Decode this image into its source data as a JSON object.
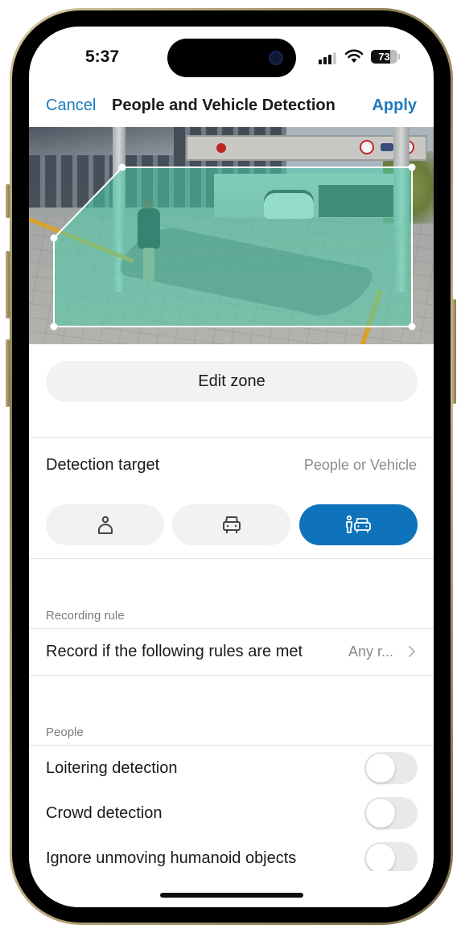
{
  "status_bar": {
    "time": "5:37",
    "battery_level": "73",
    "signal_bars_active": 3,
    "signal_bars_total": 4
  },
  "nav": {
    "cancel_label": "Cancel",
    "title": "People and Vehicle Detection",
    "apply_label": "Apply"
  },
  "camera": {
    "description": "Live camera view of parking ramp entrance with detection zone overlay",
    "zone_color": "#5fd6b4"
  },
  "edit_zone": {
    "label": "Edit zone"
  },
  "detection_target": {
    "label": "Detection target",
    "value": "People or Vehicle",
    "options": [
      {
        "name": "people",
        "icon": "person-icon",
        "selected": false
      },
      {
        "name": "vehicle",
        "icon": "car-icon",
        "selected": false
      },
      {
        "name": "people-or-vehicle",
        "icon": "person-and-car-icon",
        "selected": true
      }
    ],
    "accent_color": "#0f73bb"
  },
  "recording_rule": {
    "section_header": "Recording rule",
    "row_label": "Record if the following rules are met",
    "row_value": "Any r..."
  },
  "people": {
    "section_header": "People",
    "toggles": [
      {
        "label": "Loitering detection",
        "on": false
      },
      {
        "label": "Crowd detection",
        "on": false
      },
      {
        "label": "Ignore unmoving humanoid objects",
        "on": false
      }
    ]
  },
  "colors": {
    "link": "#1e7bbf",
    "button_bg": "#f1f2f4",
    "secondary_text": "#8a8a8e"
  }
}
